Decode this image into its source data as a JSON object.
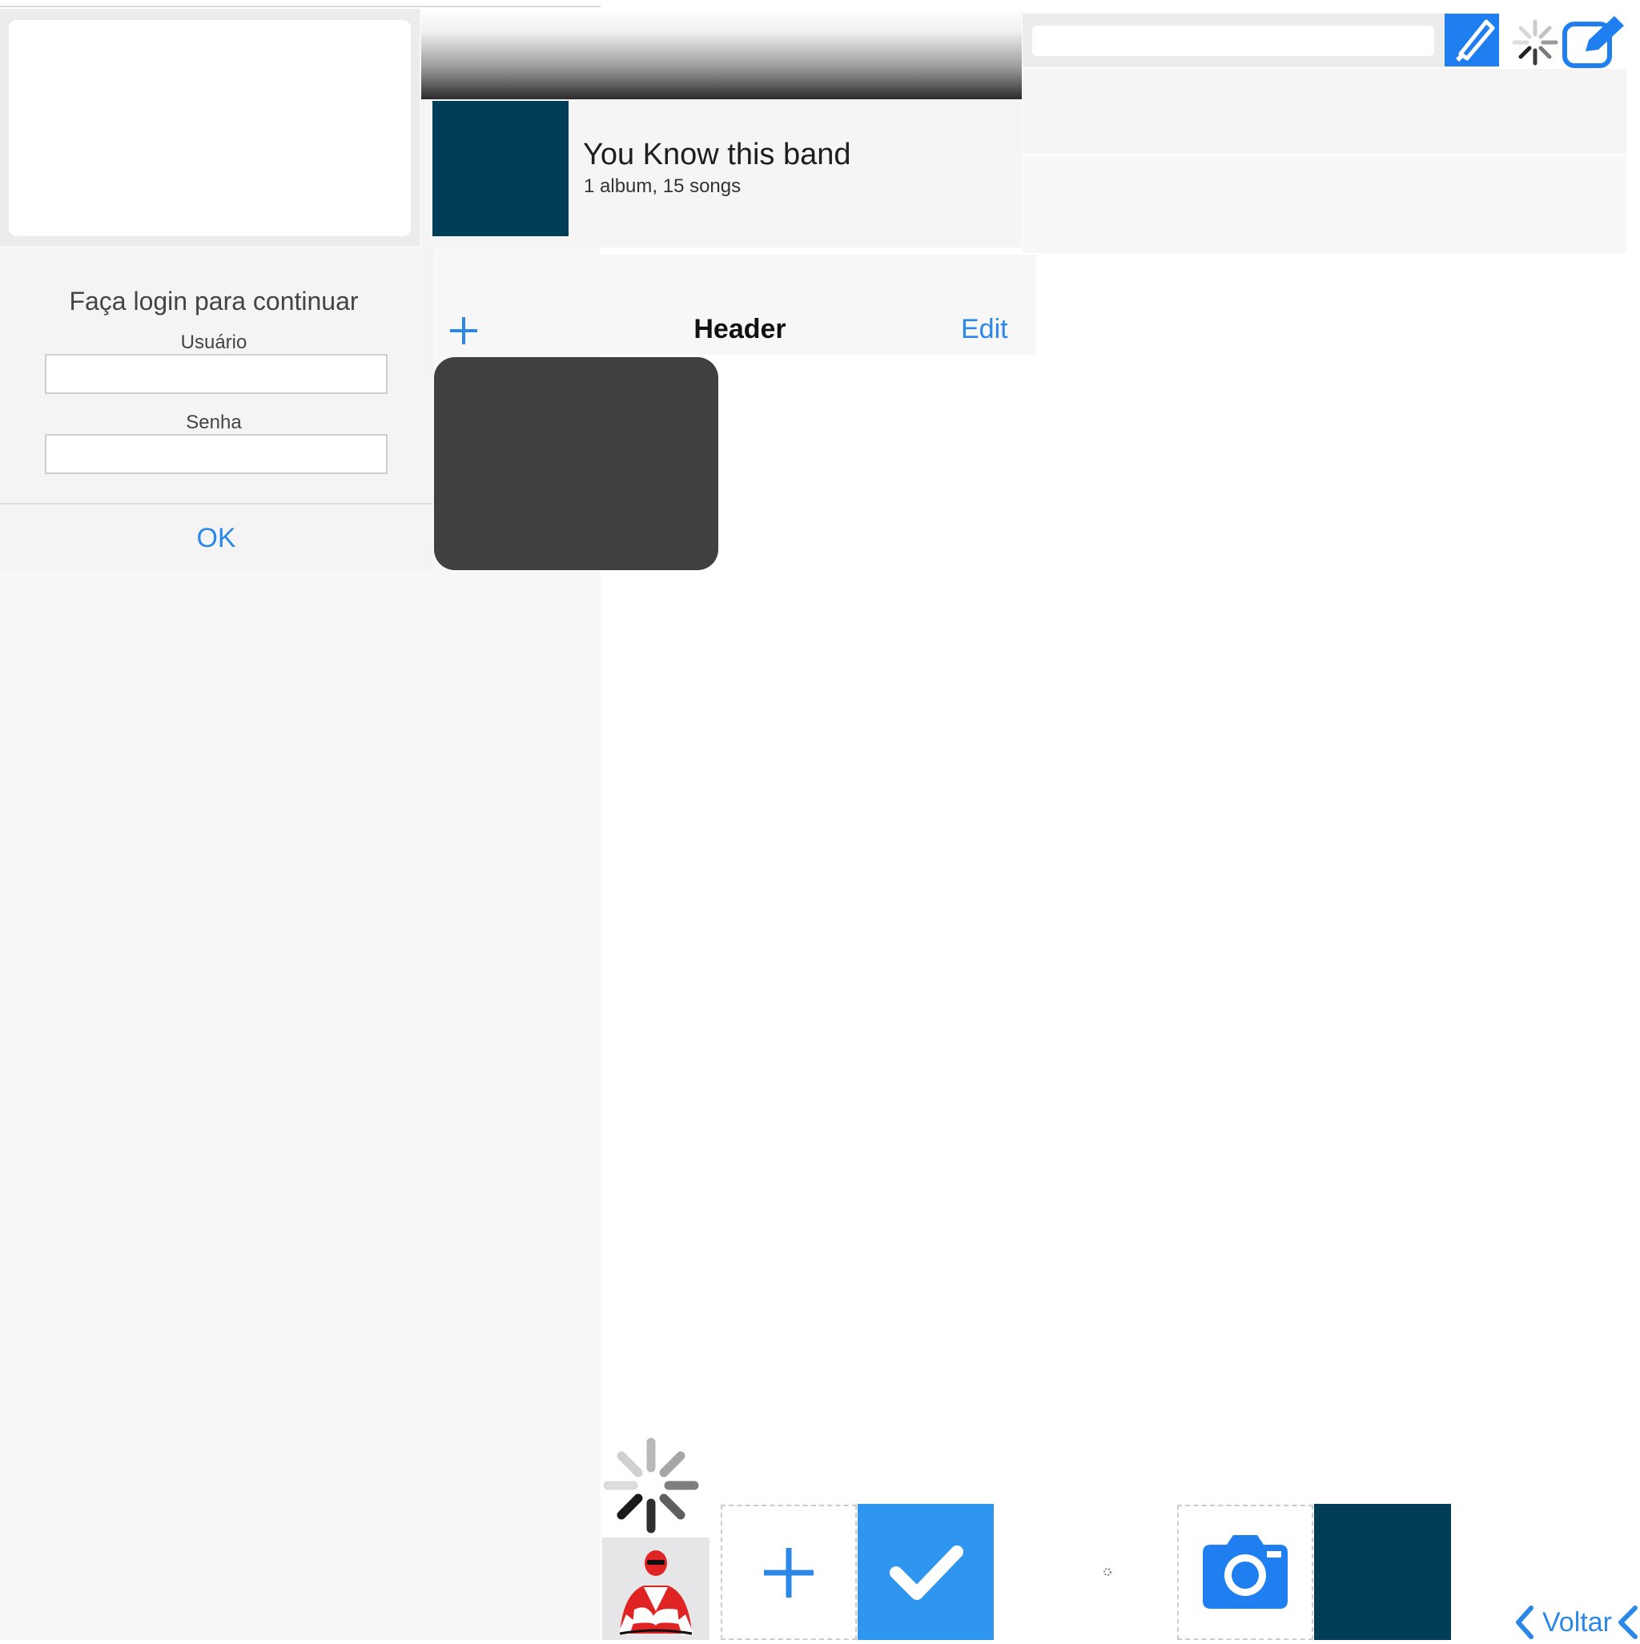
{
  "colors": {
    "accent": "#2b88e8",
    "accent_bright": "#1f7ef0",
    "album_art": "#003d56",
    "hud": "#404040",
    "check_tile": "#2f96f0",
    "panel": "#f7f7f7"
  },
  "album": {
    "title": "You Know this band",
    "subtitle": "1 album, 15 songs"
  },
  "search": {
    "placeholder": ""
  },
  "login": {
    "title": "Faça login para continuar",
    "username_label": "Usuário",
    "password_label": "Senha",
    "username_value": "",
    "password_value": "",
    "ok_label": "OK"
  },
  "header": {
    "title": "Header",
    "edit_label": "Edit",
    "add_icon": "plus-icon"
  },
  "bottom": {
    "back_label": "Voltar",
    "icons": [
      "spinner-icon",
      "ranger-avatar",
      "plus-icon",
      "checkmark-icon",
      "camera-icon",
      "chevron-left-icon"
    ]
  }
}
